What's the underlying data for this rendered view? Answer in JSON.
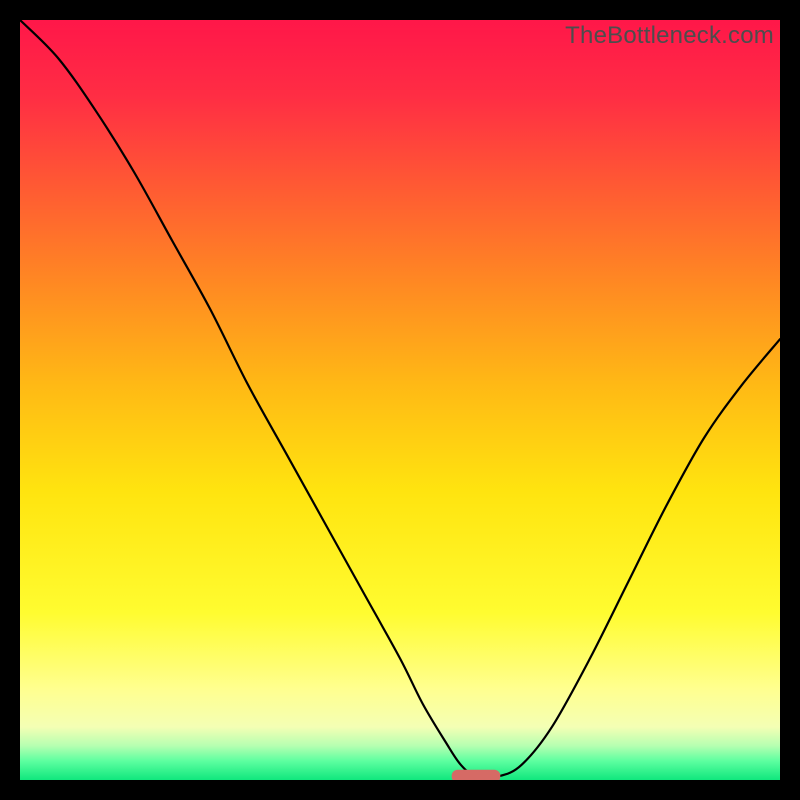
{
  "watermark": {
    "text": "TheBottleneck.com"
  },
  "chart_data": {
    "type": "line",
    "title": "",
    "xlabel": "",
    "ylabel": "",
    "xlim": [
      0,
      100
    ],
    "ylim": [
      0,
      100
    ],
    "background_gradient": {
      "stops": [
        {
          "offset": 0.0,
          "color": "#ff1749"
        },
        {
          "offset": 0.1,
          "color": "#ff2d44"
        },
        {
          "offset": 0.22,
          "color": "#ff5a33"
        },
        {
          "offset": 0.35,
          "color": "#ff8a22"
        },
        {
          "offset": 0.48,
          "color": "#ffb915"
        },
        {
          "offset": 0.62,
          "color": "#ffe40f"
        },
        {
          "offset": 0.78,
          "color": "#fffc30"
        },
        {
          "offset": 0.88,
          "color": "#ffff8f"
        },
        {
          "offset": 0.93,
          "color": "#f4ffb4"
        },
        {
          "offset": 0.955,
          "color": "#b6ffb1"
        },
        {
          "offset": 0.975,
          "color": "#5dffa0"
        },
        {
          "offset": 1.0,
          "color": "#10e77d"
        }
      ]
    },
    "series": [
      {
        "name": "bottleneck-curve",
        "x": [
          0,
          5,
          10,
          15,
          20,
          25,
          30,
          35,
          40,
          45,
          50,
          53,
          56,
          58,
          60,
          63,
          66,
          70,
          75,
          80,
          85,
          90,
          95,
          100
        ],
        "y": [
          100,
          95,
          88,
          80,
          71,
          62,
          52,
          43,
          34,
          25,
          16,
          10,
          5,
          2,
          0.5,
          0.5,
          2,
          7,
          16,
          26,
          36,
          45,
          52,
          58
        ]
      }
    ],
    "marker": {
      "name": "optimal-point",
      "x_center": 60,
      "x_halfwidth": 3.2,
      "y": 0.5,
      "color": "#d66a65"
    }
  }
}
